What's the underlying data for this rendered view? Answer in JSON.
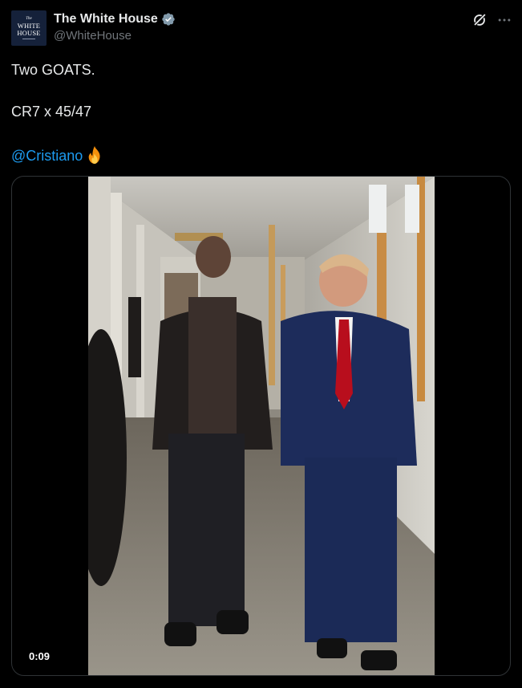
{
  "account": {
    "display_name": "The White House",
    "handle": "@WhiteHouse",
    "avatar_text": [
      "The",
      "WHITE",
      "HOUSE"
    ],
    "verified_color": "#829aab"
  },
  "tweet": {
    "line1": "Two GOATS.",
    "line2": "CR7 x 45/47",
    "mention": "@Cristiano",
    "emoji": "fire-emoji"
  },
  "media": {
    "type": "video",
    "duration": "0:09"
  },
  "colors": {
    "background": "#000000",
    "text": "#e7e9ea",
    "secondary_text": "#71767b",
    "link": "#1d9bf0"
  },
  "icons": [
    "verified-badge-icon",
    "grok-icon",
    "more-options-icon",
    "fire-emoji-icon"
  ]
}
